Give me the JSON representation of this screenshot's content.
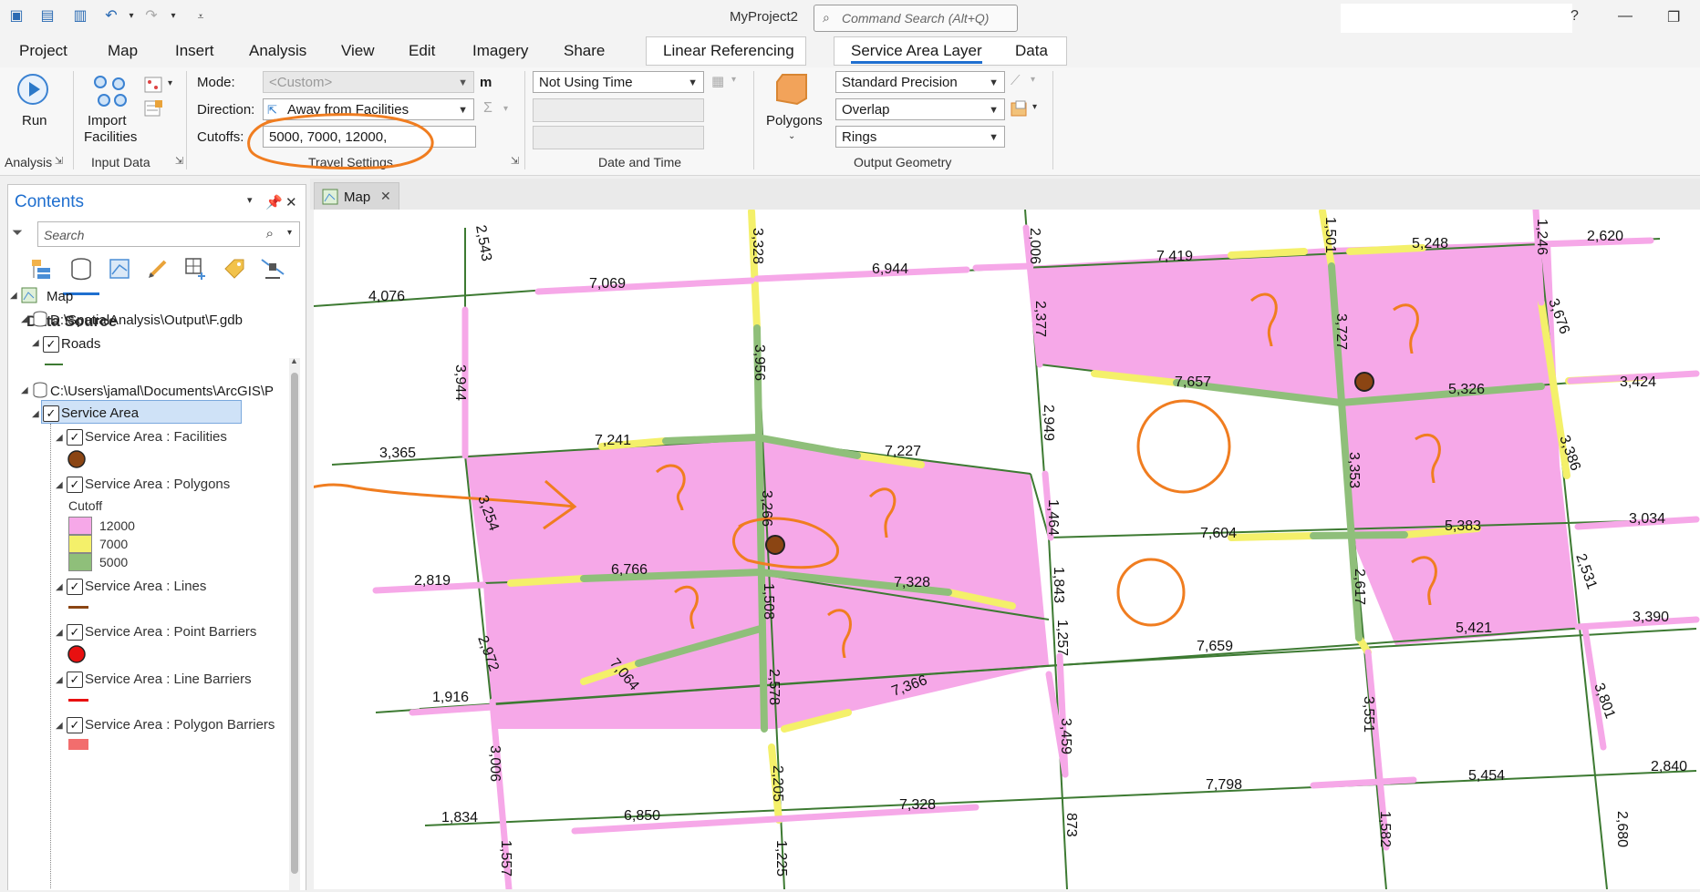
{
  "window": {
    "title": "MyProject2",
    "search_placeholder": "Command Search (Alt+Q)",
    "help": "?",
    "minimize": "—",
    "restore": "❐"
  },
  "tabs": [
    "Project",
    "Map",
    "Insert",
    "Analysis",
    "View",
    "Edit",
    "Imagery",
    "Share"
  ],
  "context_tabs": {
    "linear_referencing": "Linear Referencing",
    "service_area_layer": "Service Area Layer",
    "data": "Data"
  },
  "ribbon": {
    "analysis": {
      "run_label": "Run",
      "group_label": "Analysis"
    },
    "input_data": {
      "import_label_1": "Import",
      "import_label_2": "Facilities",
      "group_label": "Input Data"
    },
    "travel_settings": {
      "mode_label": "Mode:",
      "mode_value": "<Custom>",
      "unit": "m",
      "direction_label": "Direction:",
      "direction_value": "Away from Facilities",
      "cutoffs_label": "Cutoffs:",
      "cutoffs_value": "5000, 7000, 12000,",
      "group_label": "Travel Settings"
    },
    "date_time": {
      "time_value": "Not Using Time",
      "group_label": "Date and Time"
    },
    "output_geometry": {
      "polygons_label": "Polygons",
      "precision_value": "Standard Precision",
      "overlap_value": "Overlap",
      "rings_value": "Rings",
      "group_label": "Output Geometry"
    }
  },
  "contents": {
    "title": "Contents",
    "search_placeholder": "Search",
    "section_title": "Data Source",
    "tree": {
      "map": "Map",
      "gdb1": "D:\\SpatialAnalysis\\Output\\F.gdb",
      "roads": "Roads",
      "gdb2": "C:\\Users\\jamal\\Documents\\ArcGIS\\P",
      "service_area": "Service Area",
      "facilities": "Service Area : Facilities",
      "polygons": "Service Area : Polygons",
      "cutoff_label": "Cutoff",
      "cutoff_items": [
        "12000",
        "7000",
        "5000"
      ],
      "lines": "Service Area : Lines",
      "point_barriers": "Service Area : Point Barriers",
      "line_barriers": "Service Area : Line Barriers",
      "polygon_barriers": "Service Area : Polygon Barriers"
    }
  },
  "map_tab": {
    "label": "Map",
    "close": "✕"
  },
  "map_labels": [
    "2,543",
    "3,328",
    "2,006",
    "1,501",
    "1,246",
    "2,620",
    "5,248",
    "7,419",
    "7,069",
    "6,944",
    "4,076",
    "2,377",
    "3,727",
    "3,676",
    "3,956",
    "3,944",
    "7,657",
    "5,326",
    "3,424",
    "7,241",
    "7,227",
    "3,365",
    "2,949",
    "3,353",
    "3,386",
    "3,254",
    "3,266",
    "1,464",
    "7,604",
    "5,383",
    "3,034",
    "6,766",
    "7,328",
    "2,819",
    "1,843",
    "2,617",
    "2,531",
    "1,508",
    "1,257",
    "5,421",
    "3,390",
    "2,972",
    "7,064",
    "7,659",
    "1,916",
    "2,578",
    "7,366",
    "3,551",
    "3,801",
    "3,459",
    "3,006",
    "2,205",
    "2,840",
    "5,454",
    "7,798",
    "7,328",
    "6,850",
    "1,834",
    "873",
    "1,582",
    "2,680",
    "1,557",
    "1,225"
  ],
  "colors": {
    "cutoff_12000": "#f6a8e8",
    "cutoff_7000": "#f4f06a",
    "cutoff_5000": "#8fbf7a",
    "roads": "#3d7a32",
    "facility": "#8b4513",
    "annotation": "#f07d20",
    "accent": "#1f6fcf"
  }
}
